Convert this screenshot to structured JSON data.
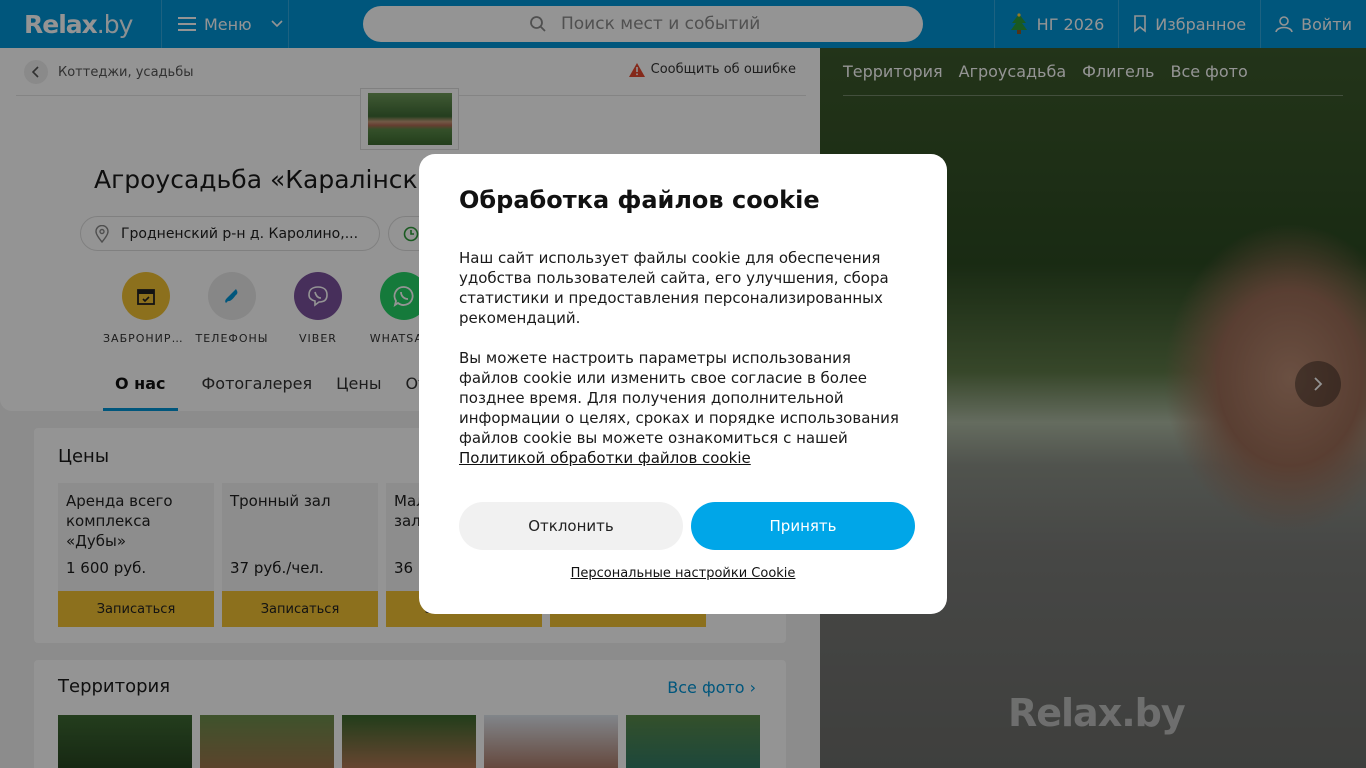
{
  "header": {
    "logo": "Relax",
    "logo_suffix": ".by",
    "menu_label": "Меню",
    "search_placeholder": "Поиск мест и событий",
    "ng_label": "НГ 2026",
    "favorites_label": "Избранное",
    "login_label": "Войти"
  },
  "page": {
    "breadcrumb": "Коттеджи, усадьбы",
    "report_error": "Сообщить об ошибке",
    "title": "Агроусадьба «Каралінскі",
    "address": "Гродненский р-н д. Каролино,...",
    "actions": [
      {
        "label": "ЗАБРОНИРОВАТЬ",
        "color": "#f2c232"
      },
      {
        "label": "ТЕЛЕФОНЫ",
        "color": "#e8e8e8"
      },
      {
        "label": "VIBER",
        "color": "#7b519d"
      },
      {
        "label": "WHATSAPP",
        "color": "#25d366"
      }
    ],
    "tabs": [
      "О нас",
      "Фотогалерея",
      "Цены",
      "Отзывы"
    ],
    "prices_title": "Цены",
    "prices": [
      {
        "name": "Аренда всего комплекса «Дубы»",
        "value": "1 600 руб.",
        "button": "Записаться"
      },
      {
        "name": "Тронный зал",
        "value": "37 руб./чел.",
        "button": "Записаться"
      },
      {
        "name": "Малый банкетный зал",
        "value": "36",
        "button": "Записаться"
      },
      {
        "name": "",
        "value": "",
        "button": "Записаться"
      }
    ],
    "territory_title": "Территория",
    "all_photos": "Все фото"
  },
  "gallery": {
    "tabs": [
      "Территория",
      "Агроусадьба",
      "Флигель",
      "Все фото"
    ],
    "watermark": "Relax.by"
  },
  "cookie": {
    "title": "Обработка файлов cookie",
    "p1": "Наш сайт использует файлы cookie для обеспечения удобства пользователей сайта, его улучшения, сбора статистики и предоставления персонализированных рекомендаций.",
    "p2": "Вы можете настроить параметры использования файлов cookie или изменить свое согласие в более позднее время. Для получения дополнительной информации о целях, сроках и порядке использования файлов cookie вы можете ознакомиться с нашей",
    "policy_link": "Политикой обработки файлов cookie",
    "decline": "Отклонить",
    "accept": "Принять",
    "personal_settings": "Персональные настройки Cookie"
  },
  "colors": {
    "brand": "#0094d6",
    "accept": "#00a6e8",
    "booking": "#f2c232"
  }
}
